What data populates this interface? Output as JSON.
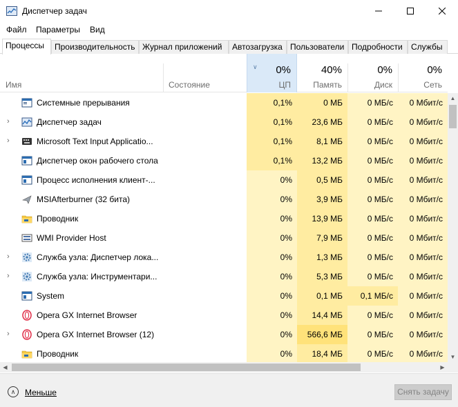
{
  "window": {
    "title": "Диспетчер задач"
  },
  "menu": [
    "Файл",
    "Параметры",
    "Вид"
  ],
  "tabs": [
    "Процессы",
    "Производительность",
    "Журнал приложений",
    "Автозагрузка",
    "Пользователи",
    "Подробности",
    "Службы"
  ],
  "active_tab": "Процессы",
  "columns": {
    "name": "Имя",
    "status": "Состояние",
    "cpu": {
      "percent": "0%",
      "label": "ЦП"
    },
    "memory": {
      "percent": "40%",
      "label": "Память"
    },
    "disk": {
      "percent": "0%",
      "label": "Диск"
    },
    "network": {
      "percent": "0%",
      "label": "Сеть"
    }
  },
  "processes": [
    {
      "name": "Системные прерывания",
      "expandable": false,
      "icon": "system-window-icon",
      "cpu": "0,1%",
      "memory": "0 МБ",
      "disk": "0 МБ/с",
      "network": "0 Мбит/с"
    },
    {
      "name": "Диспетчер задач",
      "expandable": true,
      "icon": "task-manager-icon",
      "cpu": "0,1%",
      "memory": "23,6 МБ",
      "disk": "0 МБ/с",
      "network": "0 Мбит/с"
    },
    {
      "name": "Microsoft Text Input Applicatio...",
      "expandable": true,
      "icon": "keyboard-icon",
      "cpu": "0,1%",
      "memory": "8,1 МБ",
      "disk": "0 МБ/с",
      "network": "0 Мбит/с"
    },
    {
      "name": "Диспетчер окон рабочего стола",
      "expandable": false,
      "icon": "window-icon",
      "cpu": "0,1%",
      "memory": "13,2 МБ",
      "disk": "0 МБ/с",
      "network": "0 Мбит/с"
    },
    {
      "name": "Процесс исполнения клиент-...",
      "expandable": false,
      "icon": "window-icon",
      "cpu": "0%",
      "memory": "0,5 МБ",
      "disk": "0 МБ/с",
      "network": "0 Мбит/с"
    },
    {
      "name": "MSIAfterburner (32 бита)",
      "expandable": false,
      "icon": "airplane-icon",
      "cpu": "0%",
      "memory": "3,9 МБ",
      "disk": "0 МБ/с",
      "network": "0 Мбит/с"
    },
    {
      "name": "Проводник",
      "expandable": false,
      "icon": "folder-icon",
      "cpu": "0%",
      "memory": "13,9 МБ",
      "disk": "0 МБ/с",
      "network": "0 Мбит/с"
    },
    {
      "name": "WMI Provider Host",
      "expandable": false,
      "icon": "wmi-icon",
      "cpu": "0%",
      "memory": "7,9 МБ",
      "disk": "0 МБ/с",
      "network": "0 Мбит/с"
    },
    {
      "name": "Служба узла: Диспетчер лока...",
      "expandable": true,
      "icon": "gear-icon",
      "cpu": "0%",
      "memory": "1,3 МБ",
      "disk": "0 МБ/с",
      "network": "0 Мбит/с"
    },
    {
      "name": "Служба узла: Инструментари...",
      "expandable": true,
      "icon": "gear-icon",
      "cpu": "0%",
      "memory": "5,3 МБ",
      "disk": "0 МБ/с",
      "network": "0 Мбит/с"
    },
    {
      "name": "System",
      "expandable": false,
      "icon": "window-icon",
      "cpu": "0%",
      "memory": "0,1 МБ",
      "disk": "0,1 МБ/с",
      "network": "0 Мбит/с"
    },
    {
      "name": "Opera GX Internet Browser",
      "expandable": false,
      "icon": "opera-icon",
      "cpu": "0%",
      "memory": "14,4 МБ",
      "disk": "0 МБ/с",
      "network": "0 Мбит/с"
    },
    {
      "name": "Opera GX Internet Browser (12)",
      "expandable": true,
      "icon": "opera-icon",
      "cpu": "0%",
      "memory": "566,6 МБ",
      "disk": "0 МБ/с",
      "network": "0 Мбит/с"
    },
    {
      "name": "Проводник",
      "expandable": false,
      "icon": "folder-icon",
      "cpu": "0%",
      "memory": "18,4 МБ",
      "disk": "0 МБ/с",
      "network": "0 Мбит/с"
    }
  ],
  "footer": {
    "fewer_details": "Меньше",
    "end_task": "Снять задачу"
  },
  "colors": {
    "cpu_header_bg": "#dae9f8",
    "heat_light": "#fff4c4",
    "heat_medium": "#ffeca1",
    "heat_strong": "#ffe27a"
  }
}
